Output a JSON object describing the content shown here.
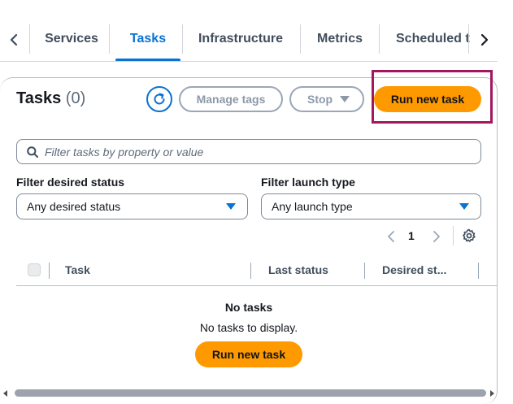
{
  "tabs": [
    {
      "label": "Services",
      "active": false
    },
    {
      "label": "Tasks",
      "active": true
    },
    {
      "label": "Infrastructure",
      "active": false
    },
    {
      "label": "Metrics",
      "active": false
    },
    {
      "label": "Scheduled t",
      "active": false
    }
  ],
  "header": {
    "title": "Tasks",
    "count": "(0)"
  },
  "actions": {
    "manage_tags": "Manage tags",
    "stop": "Stop",
    "run_new_task": "Run new task"
  },
  "search": {
    "placeholder": "Filter tasks by property or value"
  },
  "filters": {
    "desired_status": {
      "label": "Filter desired status",
      "value": "Any desired status"
    },
    "launch_type": {
      "label": "Filter launch type",
      "value": "Any launch type"
    }
  },
  "pagination": {
    "current_page": "1"
  },
  "table": {
    "columns": [
      "Task",
      "Last status",
      "Desired st..."
    ]
  },
  "empty_state": {
    "title": "No tasks",
    "description": "No tasks to display.",
    "button": "Run new task"
  },
  "colors": {
    "accent": "#0972d3",
    "primary_button": "#ff9900",
    "highlight": "#a3175f"
  }
}
